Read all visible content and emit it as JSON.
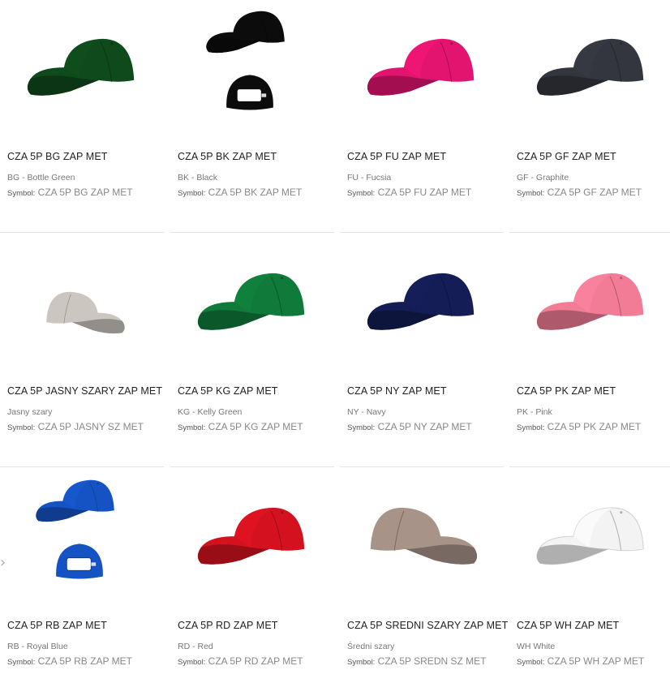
{
  "products": [
    {
      "title": "CZA 5P BG ZAP MET",
      "color_name": "BG - Bottle Green",
      "symbol_label": "Symbol:",
      "symbol": "CZA 5P BG ZAP MET",
      "cap_color": "#0f4a1c",
      "style": "front-left"
    },
    {
      "title": "CZA 5P BK ZAP MET",
      "color_name": "BK - Black",
      "symbol_label": "Symbol:",
      "symbol": "CZA 5P BK ZAP MET",
      "cap_color": "#0c0c0c",
      "style": "double"
    },
    {
      "title": "CZA 5P FU ZAP MET",
      "color_name": "FU - Fucsia",
      "symbol_label": "Symbol:",
      "symbol": "CZA 5P FU ZAP MET",
      "cap_color": "#e3146f",
      "style": "front-left"
    },
    {
      "title": "CZA 5P GF ZAP MET",
      "color_name": "GF - Graphite",
      "symbol_label": "Symbol:",
      "symbol": "CZA 5P GF ZAP MET",
      "cap_color": "#34363f",
      "style": "front-left"
    },
    {
      "title": "CZA 5P JASNY SZARY ZAP MET",
      "color_name": "Jasny szary",
      "symbol_label": "Symbol:",
      "symbol": "CZA 5P JASNY SZ MET",
      "cap_color": "#cbc6c0",
      "style": "side-small"
    },
    {
      "title": "CZA 5P KG ZAP MET",
      "color_name": "KG - Kelly Green",
      "symbol_label": "Symbol:",
      "symbol": "CZA 5P KG ZAP MET",
      "cap_color": "#0f7a3a",
      "style": "front-left"
    },
    {
      "title": "CZA 5P NY ZAP MET",
      "color_name": "NY - Navy",
      "symbol_label": "Symbol:",
      "symbol": "CZA 5P NY ZAP MET",
      "cap_color": "#141d55",
      "style": "front-left"
    },
    {
      "title": "CZA 5P PK ZAP MET",
      "color_name": "PK - Pink",
      "symbol_label": "Symbol:",
      "symbol": "CZA 5P PK ZAP MET",
      "cap_color": "#f27c96",
      "style": "front-left"
    },
    {
      "title": "CZA 5P RB ZAP MET",
      "color_name": "RB - Royal Blue",
      "symbol_label": "Symbol:",
      "symbol": "CZA 5P RB ZAP MET",
      "cap_color": "#1553c4",
      "style": "double"
    },
    {
      "title": "CZA 5P RD ZAP MET",
      "color_name": "RD - Red",
      "symbol_label": "Symbol:",
      "symbol": "CZA 5P RD ZAP MET",
      "cap_color": "#d4121f",
      "style": "front-left"
    },
    {
      "title": "CZA 5P SREDNI SZARY ZAP MET",
      "color_name": "Średni szary",
      "symbol_label": "Symbol:",
      "symbol": "CZA 5P SREDN SZ MET",
      "cap_color": "#a79388",
      "style": "front-right"
    },
    {
      "title": "CZA 5P WH ZAP MET",
      "color_name": "WH White",
      "symbol_label": "Symbol:",
      "symbol": "CZA 5P WH ZAP MET",
      "cap_color": "#f3f3f3",
      "style": "front-left"
    }
  ],
  "carousel_prev_icon": "chevron-left-icon"
}
